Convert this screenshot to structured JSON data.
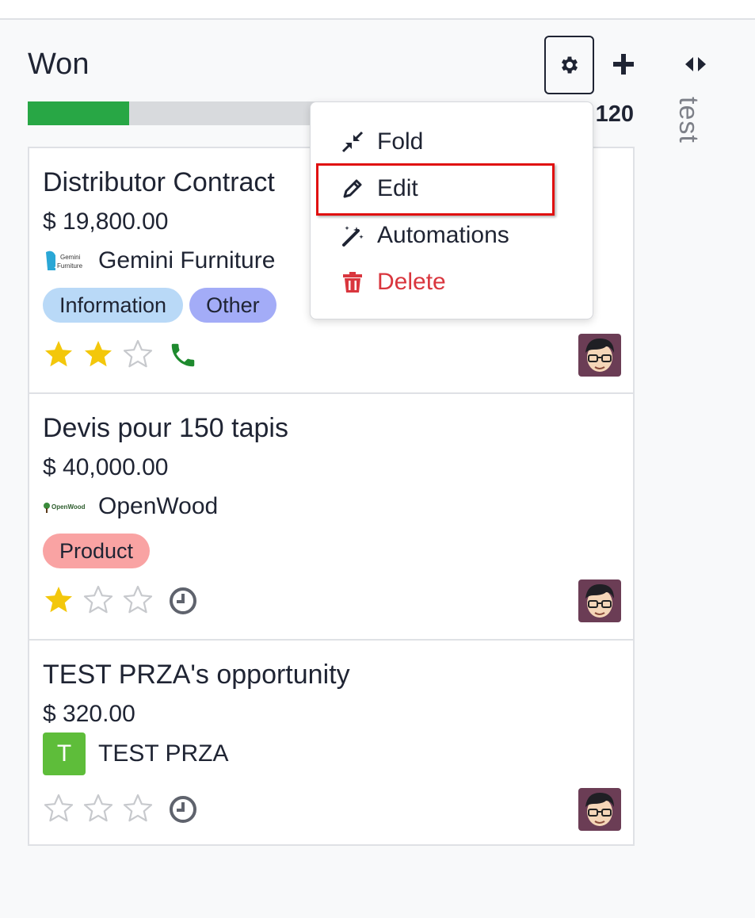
{
  "column": {
    "title": "Won",
    "total": "120",
    "progress_fraction": 0.305,
    "progress_color": "#28a745"
  },
  "folded_column": {
    "label": "test"
  },
  "settings_menu": {
    "items": [
      {
        "label": "Fold",
        "icon": "compress-icon"
      },
      {
        "label": "Edit",
        "icon": "pencil-icon"
      },
      {
        "label": "Automations",
        "icon": "magic-wand-icon"
      },
      {
        "label": "Delete",
        "icon": "trash-icon",
        "color": "#d9363e"
      }
    ],
    "highlighted_item": "Edit"
  },
  "cards": [
    {
      "title": "Distributor Contract",
      "amount": "$ 19,800.00",
      "partner": "Gemini Furniture",
      "partner_logo_text": [
        "Gemini",
        "Furniture"
      ],
      "tags": [
        {
          "label": "Information",
          "color": "#b9d9f7"
        },
        {
          "label": "Other",
          "color": "#a3acf7"
        }
      ],
      "stars": 2,
      "activity": "phone-icon",
      "activity_color": "#1e8a2e"
    },
    {
      "title": "Devis pour 150 tapis",
      "amount": "$ 40,000.00",
      "partner": "OpenWood",
      "partner_logo_text": "OpenWood",
      "tags": [
        {
          "label": "Product",
          "color": "#f9a3a3"
        }
      ],
      "stars": 1,
      "activity": "clock-icon",
      "activity_color": "#5f636d"
    },
    {
      "title": "TEST PRZA's opportunity",
      "amount": "$ 320.00",
      "partner": "TEST PRZA",
      "partner_initial": "T",
      "tags": [],
      "stars": 0,
      "activity": "clock-icon",
      "activity_color": "#5f636d"
    }
  ],
  "colors": {
    "star_filled": "#f3c70b",
    "star_empty": "#c7c9cd",
    "partner_initial_bg": "#5ebd3a"
  }
}
